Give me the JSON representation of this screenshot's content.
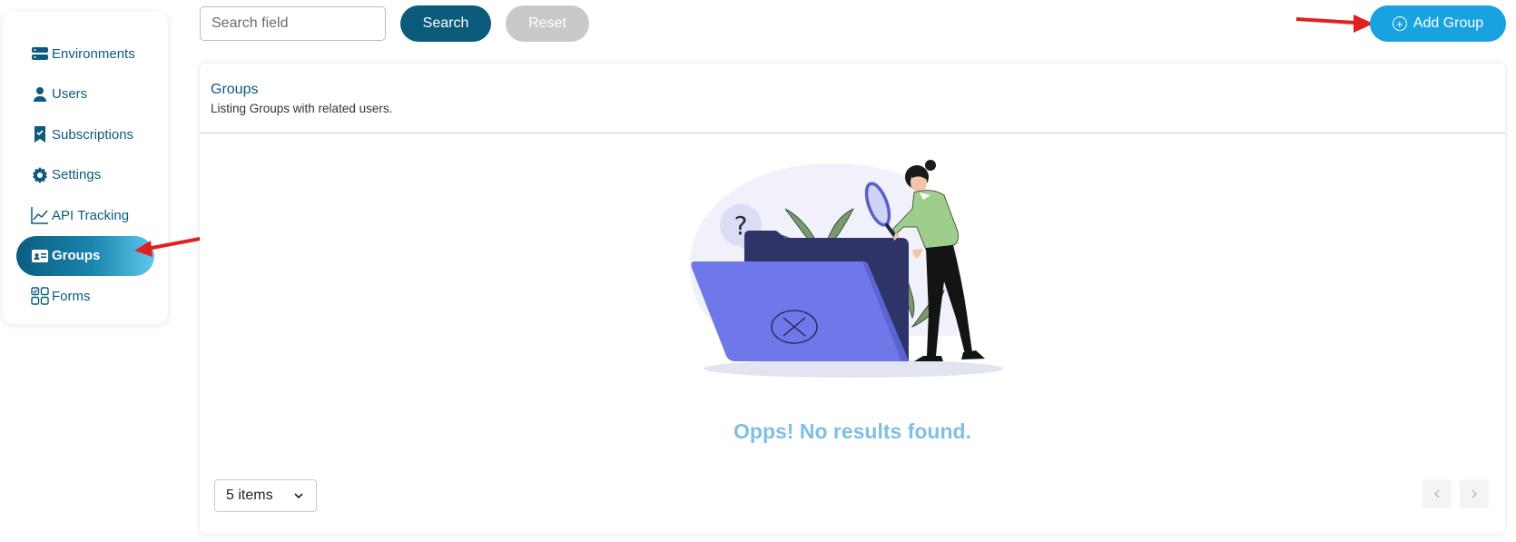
{
  "sidebar": {
    "items": [
      {
        "label": "Environments",
        "icon": "server-icon"
      },
      {
        "label": "Users",
        "icon": "user-icon"
      },
      {
        "label": "Subscriptions",
        "icon": "bookmark-icon"
      },
      {
        "label": "Settings",
        "icon": "gear-icon"
      },
      {
        "label": "API Tracking",
        "icon": "chart-line-icon"
      },
      {
        "label": "Groups",
        "icon": "id-card-icon",
        "active": true
      },
      {
        "label": "Forms",
        "icon": "grid-icon"
      }
    ]
  },
  "toolbar": {
    "search_placeholder": "Search field",
    "search_label": "Search",
    "reset_label": "Reset",
    "add_label": "Add Group"
  },
  "card": {
    "title": "Groups",
    "subtitle": "Listing Groups with related users.",
    "empty_message": "Opps! No results found."
  },
  "pagination": {
    "page_size": "5 items"
  },
  "colors": {
    "primary": "#0b5a7a",
    "accent": "#18a3e0",
    "empty_text": "#7fbfe6",
    "annotation_arrow": "#e02020"
  }
}
